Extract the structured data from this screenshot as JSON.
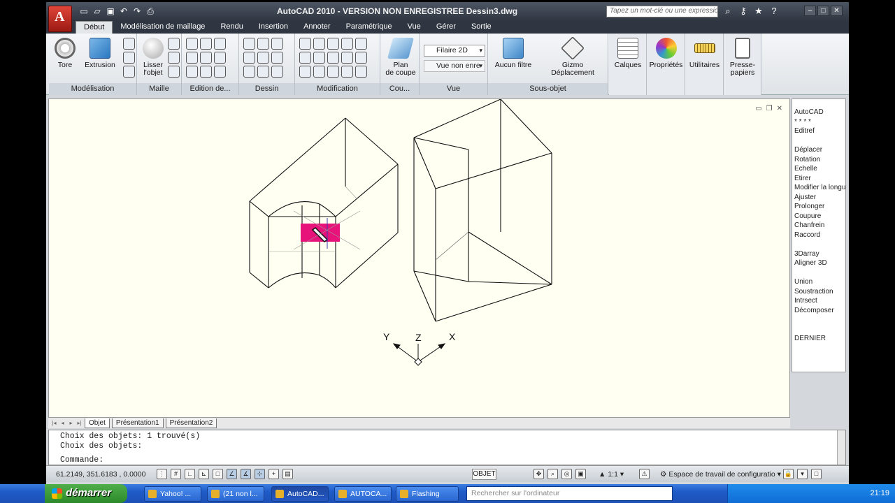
{
  "window": {
    "title": "AutoCAD 2010 - VERSION NON ENREGISTREE    Dessin3.dwg",
    "search_placeholder": "Tapez un mot-clé ou une expressio"
  },
  "tabs": [
    "Début",
    "Modélisation de maillage",
    "Rendu",
    "Insertion",
    "Annoter",
    "Paramétrique",
    "Vue",
    "Gérer",
    "Sortie"
  ],
  "ribbon": {
    "panels": [
      "Modélisation",
      "Maille",
      "Edition de...",
      "Dessin",
      "Modification",
      "Cou...",
      "Vue",
      "Sous-objet"
    ],
    "tools": {
      "tore": "Tore",
      "extrusion": "Extrusion",
      "lisser_1": "Lisser",
      "lisser_2": "l'objet",
      "plan_1": "Plan",
      "plan_2": "de coupe",
      "filaire": "Filaire 2D",
      "vue_non_enreg": "Vue non enre",
      "aucun_filtre": "Aucun filtre",
      "gizmo": "Gizmo Déplacement",
      "calques": "Calques",
      "proprietes": "Propriétés",
      "utilitaires": "Utilitaires",
      "presse_1": "Presse-",
      "presse_2": "papiers"
    }
  },
  "ucs": {
    "x": "X",
    "y": "Y",
    "z": "Z"
  },
  "palette": [
    "AutoCAD",
    "* * * *",
    "Editref",
    "",
    "Déplacer",
    "Rotation",
    "Echelle",
    "Etirer",
    "Modifier la longueur",
    "Ajuster",
    "Prolonger",
    "Coupure",
    "Chanfrein",
    "Raccord",
    "",
    "3Darray",
    "Aligner 3D",
    "",
    "Union",
    "Soustraction",
    "Intrsect",
    "Décomposer",
    "",
    "",
    "DERNIER"
  ],
  "layout_tabs": [
    "Objet",
    "Présentation1",
    "Présentation2"
  ],
  "command": {
    "line1": "Choix des objets: 1 trouvé(s)",
    "line2": "Choix des objets:",
    "prompt": "Commande:"
  },
  "status": {
    "coords": "61.2149, 351.6183 , 0.0000",
    "objet": "OBJET",
    "scale": "1:1",
    "workspace": "Espace de travail de configuratio"
  },
  "taskbar": {
    "start": "démarrer",
    "tasks": [
      "Yahoo! ...",
      "(21 non l...",
      "AutoCAD...",
      "AUTOCA...",
      "Flashing"
    ],
    "search": "Rechercher sur l'ordinateur",
    "clock": "21:19"
  },
  "colors": {
    "grip": "#e8137a",
    "canvas": "#fffff2"
  }
}
